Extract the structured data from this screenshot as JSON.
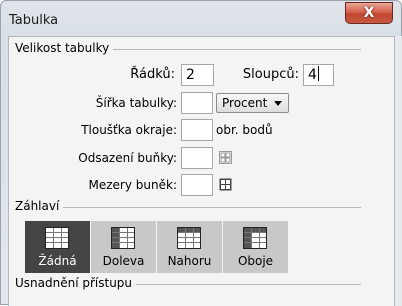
{
  "window": {
    "title": "Tabulka",
    "close_glyph": "X"
  },
  "size_section": {
    "legend": "Velikost tabulky",
    "rows_label": "Řádků:",
    "rows_value": "2",
    "cols_label": "Sloupců:",
    "cols_value": "4",
    "width_label": "Šířka tabulky:",
    "width_value": "",
    "width_unit": "Procent",
    "border_label": "Tloušťka okraje:",
    "border_value": "",
    "border_unit": "obr. bodů",
    "padding_label": "Odsazení buňky:",
    "padding_value": "",
    "spacing_label": "Mezery buněk:",
    "spacing_value": ""
  },
  "header_section": {
    "legend": "Záhlaví",
    "options": [
      {
        "label": "Žádná",
        "selected": true,
        "icon": "table-no-header-icon"
      },
      {
        "label": "Doleva",
        "selected": false,
        "icon": "table-left-header-icon"
      },
      {
        "label": "Nahoru",
        "selected": false,
        "icon": "table-top-header-icon"
      },
      {
        "label": "Oboje",
        "selected": false,
        "icon": "table-both-header-icon"
      }
    ]
  },
  "accessibility_section": {
    "legend": "Usnadnění přístupu"
  },
  "colors": {
    "selected_option": "#444444",
    "option": "#c8c8c8",
    "close_button": "#c94a33"
  }
}
